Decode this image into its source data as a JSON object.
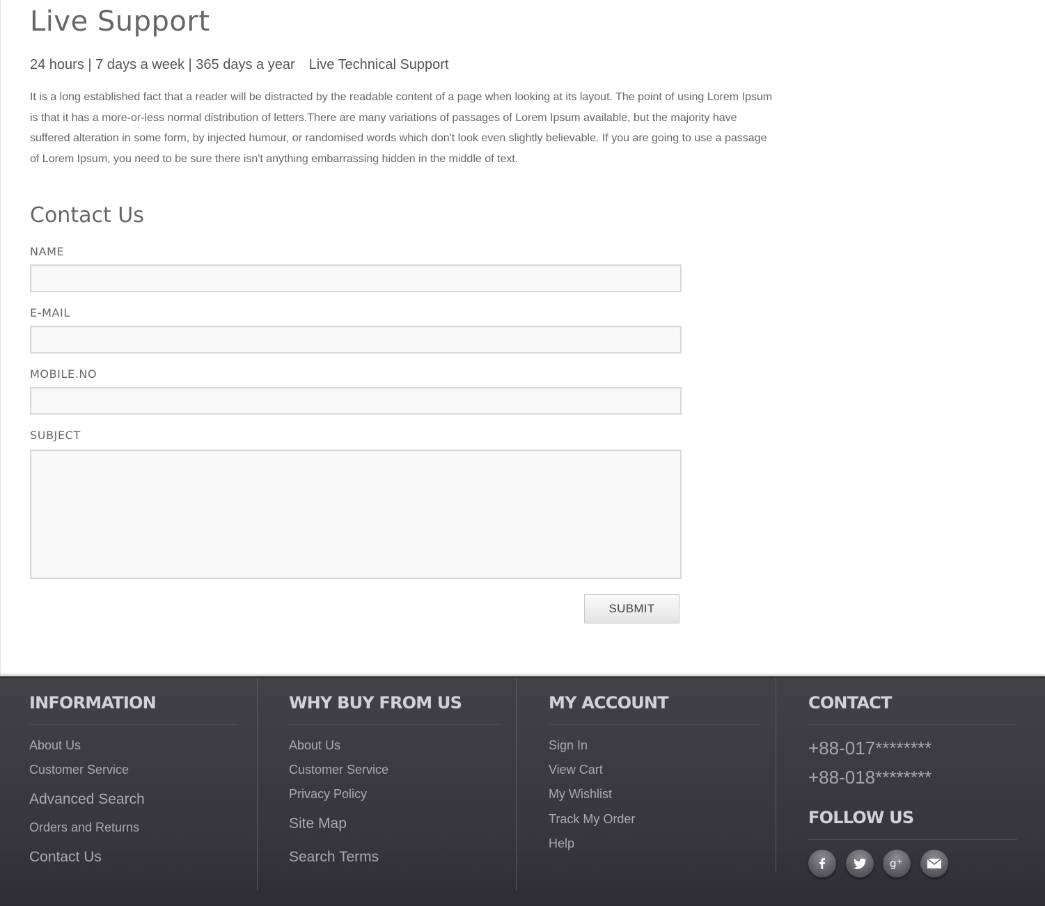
{
  "page_title": "Live Support",
  "tagline": {
    "availability": "24 hours | 7 days a week | 365 days a year",
    "service": "Live Technical Support"
  },
  "intro_text": "It is a long established fact that a reader will be distracted by the readable content of a page when looking at its layout. The point of using Lorem Ipsum is that it has a more-or-less normal distribution of letters.There are many variations of passages of Lorem Ipsum available, but the majority have suffered alteration in some form, by injected humour, or randomised words which don't look even slightly believable. If you are going to use a passage of Lorem Ipsum, you need to be sure there isn't anything embarrassing hidden in the middle of text.",
  "contact_form": {
    "title": "Contact Us",
    "name_label": "NAME",
    "name_value": "",
    "email_label": "E-MAIL",
    "email_value": "",
    "mobile_label": "MOBILE.NO",
    "mobile_value": "",
    "subject_label": "SUBJECT",
    "subject_value": "",
    "submit_label": "SUBMIT"
  },
  "footer": {
    "information": {
      "title": "INFORMATION",
      "links": [
        "About Us",
        "Customer Service",
        "Advanced Search",
        "Orders and Returns",
        "Contact Us"
      ]
    },
    "why_buy": {
      "title": "WHY BUY FROM US",
      "links": [
        "About Us",
        "Customer Service",
        "Privacy Policy",
        "Site Map",
        "Search Terms"
      ]
    },
    "my_account": {
      "title": "MY ACCOUNT",
      "links": [
        "Sign In",
        "View Cart",
        "My Wishlist",
        "Track My Order",
        "Help"
      ]
    },
    "contact": {
      "title": "CONTACT",
      "phones": [
        "+88-017********",
        "+88-018********"
      ],
      "follow_title": "FOLLOW US",
      "social_icons": [
        "facebook-icon",
        "twitter-icon",
        "google-plus-icon",
        "email-icon"
      ]
    }
  },
  "colors": {
    "footer_background": "#3a3a3f",
    "footer_heading": "#d2d2d6",
    "footer_link": "#a9a9ae",
    "body_text": "#666666"
  }
}
